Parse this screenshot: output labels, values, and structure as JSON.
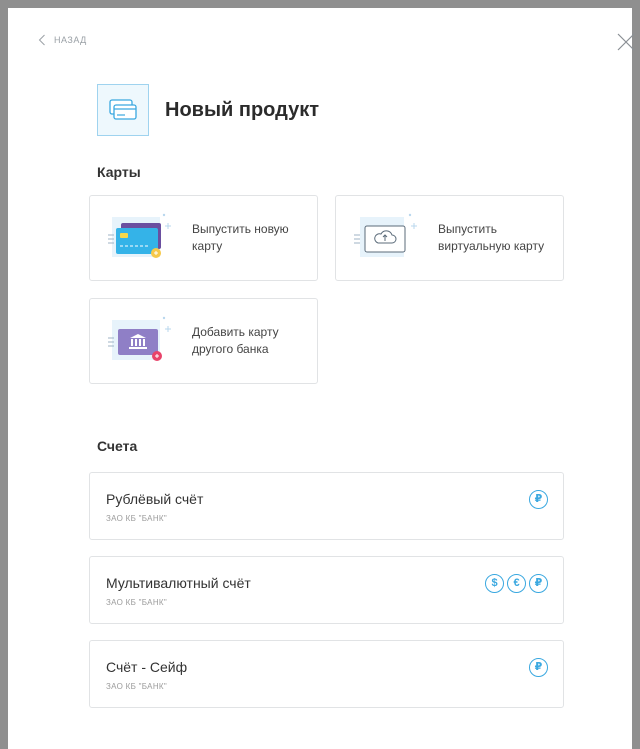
{
  "nav": {
    "back_label": "НАЗАД"
  },
  "header": {
    "title": "Новый продукт"
  },
  "cards_section": {
    "title": "Карты",
    "items": [
      {
        "label": "Выпустить новую карту"
      },
      {
        "label": "Выпустить виртуальную карту"
      },
      {
        "label": "Добавить карту другого банка"
      }
    ]
  },
  "accounts_section": {
    "title": "Счета",
    "items": [
      {
        "name": "Рублёвый счёт",
        "bank": "ЗАО КБ \"БАНК\"",
        "currencies": [
          "₽"
        ]
      },
      {
        "name": "Мультивалютный счёт",
        "bank": "ЗАО КБ \"БАНК\"",
        "currencies": [
          "$",
          "€",
          "₽"
        ]
      },
      {
        "name": "Счёт - Сейф",
        "bank": "ЗАО КБ \"БАНК\"",
        "currencies": [
          "₽"
        ]
      }
    ]
  },
  "colors": {
    "accent": "#3aa8e0",
    "border": "#e1e3e5",
    "frame": "#8f8f8f"
  }
}
